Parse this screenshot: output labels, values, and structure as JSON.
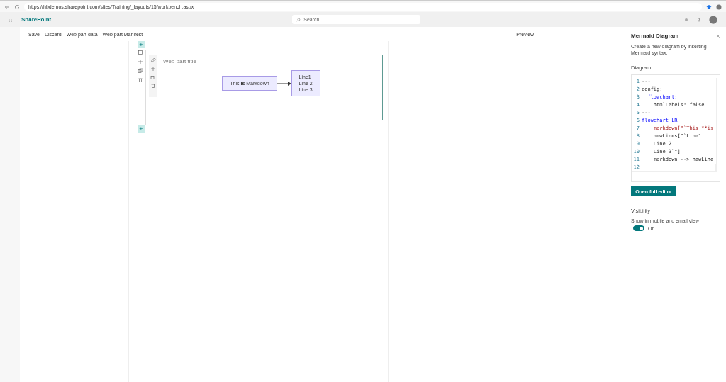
{
  "browser": {
    "url": "https://hbdemos.sharepoint.com/sites/Training/_layouts/15/workbench.aspx"
  },
  "suite_bar": {
    "app_name": "SharePoint",
    "search": {
      "placeholder": "Search"
    }
  },
  "command_bar": {
    "items": [
      "Save",
      "Discard",
      "Web part data",
      "Web part Manifest"
    ],
    "preview": "Preview"
  },
  "web_part": {
    "add_buttons": [
      "+",
      "+"
    ],
    "title": "Web part title",
    "diagram": {
      "source_node": "This **is** Markdown",
      "target_node_lines": [
        "Line1",
        "Line 2",
        "Line 3"
      ]
    }
  },
  "panel": {
    "title": "Mermaid Diagram",
    "description": "Create a new diagram by inserting Mermaid syntax.",
    "diagram_label": "Diagram",
    "code_lines": [
      {
        "number": "1",
        "text": "---",
        "kind": "plain"
      },
      {
        "number": "2",
        "text": "config:",
        "kind": "plain"
      },
      {
        "number": "3",
        "text": "  flowchart:",
        "kind": "keyword"
      },
      {
        "number": "4",
        "text": "    htmlLabels: false",
        "kind": "plain"
      },
      {
        "number": "5",
        "text": "---",
        "kind": "plain"
      },
      {
        "number": "6",
        "text": "flowchart LR",
        "kind": "keyword"
      },
      {
        "number": "7",
        "text": "    markdown[\"`This **is",
        "kind": "string"
      },
      {
        "number": "8",
        "text": "    newLines[\"`Line1",
        "kind": "plain"
      },
      {
        "number": "9",
        "text": "    Line 2",
        "kind": "plain"
      },
      {
        "number": "10",
        "text": "    Line 3`\"]",
        "kind": "plain"
      },
      {
        "number": "11",
        "text": "    markdown --> newLine",
        "kind": "plain"
      },
      {
        "number": "12",
        "kind": "current"
      }
    ],
    "open_button": "Open full editor",
    "visibility_label": "Visibility",
    "toggle_label": "Show in mobile and email view",
    "toggle": {
      "on": true,
      "text": "On"
    }
  }
}
